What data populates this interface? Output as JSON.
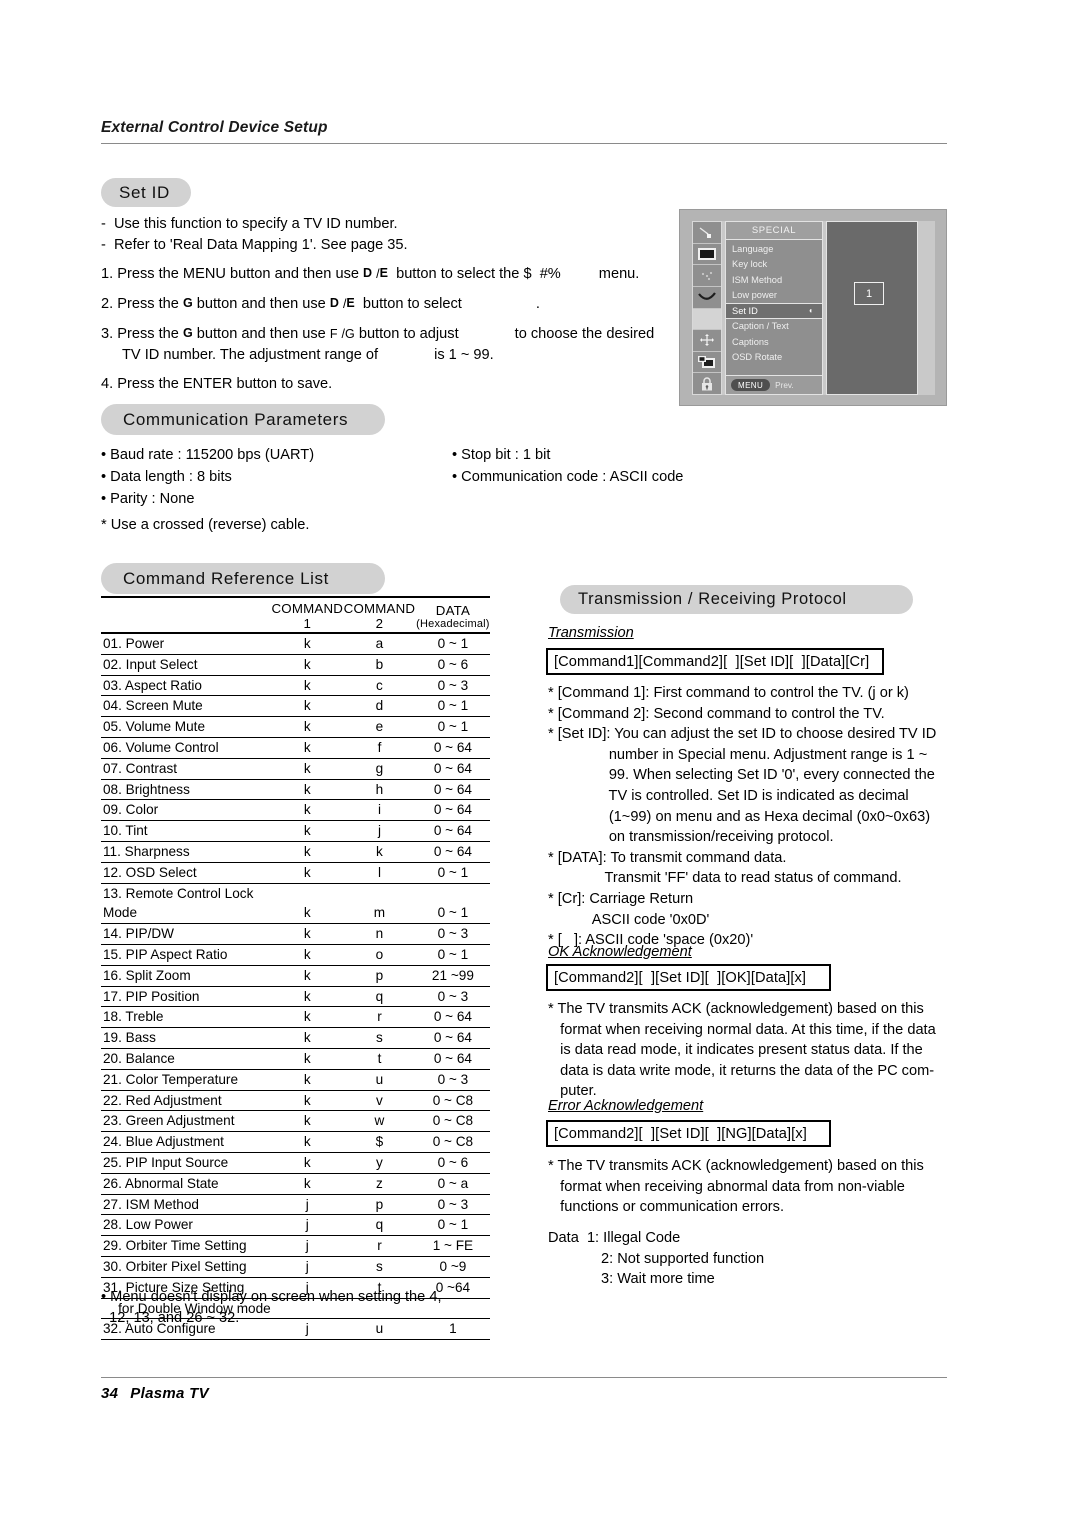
{
  "running_head": "External Control Device Setup",
  "sections": {
    "set_id": {
      "title": "Set ID",
      "dashes": [
        "-  Use this function to specify a TV ID number.",
        "-  Refer to 'Real Data Mapping 1'. See page 35."
      ],
      "steps": [
        {
          "num": "1.",
          "a": "Press the MENU button and then use",
          "sym1": "D",
          "slash": "/",
          "sym2": "E",
          "b": "button to select the",
          "glyph": "$  #%",
          "c": "menu."
        },
        {
          "num": "2.",
          "a": "Press the",
          "sym1": "G",
          "b": "button and then use",
          "sym2": "D",
          "slash": "/",
          "sym3": "E",
          "c": "button to select",
          "d": "."
        },
        {
          "num": "3.",
          "a": "Press the",
          "sym1": "G",
          "b": "button and then use",
          "sym2": "F",
          "slash": "/",
          "sym3": "G",
          "c": "button to adjust",
          "d": "to choose the desired",
          "line2a": "TV ID number. The adjustment range of",
          "line2b": "is 1 ~ 99."
        },
        {
          "num": "4.",
          "a": "Press the ENTER button to save."
        }
      ]
    },
    "osd": {
      "title": "SPECIAL",
      "items": [
        {
          "label": "Language",
          "active": false,
          "arrow": ""
        },
        {
          "label": "Key lock",
          "active": false,
          "arrow": ""
        },
        {
          "label": "ISM Method",
          "active": false,
          "arrow": ""
        },
        {
          "label": "Low power",
          "active": false,
          "arrow": ""
        },
        {
          "label": "Set ID",
          "active": true,
          "arrow": "◖"
        },
        {
          "label": "Caption / Text",
          "active": false,
          "arrow": ""
        },
        {
          "label": "Captions",
          "active": false,
          "arrow": ""
        },
        {
          "label": "OSD Rotate",
          "active": false,
          "arrow": ""
        }
      ],
      "footer_button": "MENU",
      "footer_label": "Prev.",
      "value": "1"
    },
    "communication_parameters": {
      "title": "Communication Parameters",
      "left_bullets": [
        "• Baud rate : 115200 bps (UART)",
        "• Data length : 8 bits",
        "• Parity : None"
      ],
      "right_bullets": [
        "• Stop bit : 1 bit",
        "• Communication code : ASCII code"
      ],
      "note": "* Use a crossed (reverse) cable."
    },
    "command_reference_list": {
      "title": "Command Reference List",
      "columns": [
        "",
        "COMMAND 1",
        "COMMAND 2",
        "DATA"
      ],
      "data_sub_label": "(Hexadecimal)",
      "rows": [
        {
          "name": "01. Power",
          "c1": "k",
          "c2": "a",
          "data": "0 ~ 1"
        },
        {
          "name": "02. Input Select",
          "c1": "k",
          "c2": "b",
          "data": "0 ~ 6"
        },
        {
          "name": "03. Aspect Ratio",
          "c1": "k",
          "c2": "c",
          "data": "0 ~ 3"
        },
        {
          "name": "04. Screen Mute",
          "c1": "k",
          "c2": "d",
          "data": "0 ~ 1"
        },
        {
          "name": "05. Volume Mute",
          "c1": "k",
          "c2": "e",
          "data": "0 ~ 1"
        },
        {
          "name": "06. Volume Control",
          "c1": "k",
          "c2": "f",
          "data": "0 ~ 64"
        },
        {
          "name": "07. Contrast",
          "c1": "k",
          "c2": "g",
          "data": "0 ~ 64"
        },
        {
          "name": "08. Brightness",
          "c1": "k",
          "c2": "h",
          "data": "0 ~ 64"
        },
        {
          "name": "09. Color",
          "c1": "k",
          "c2": "i",
          "data": "0 ~ 64"
        },
        {
          "name": "10. Tint",
          "c1": "k",
          "c2": "j",
          "data": "0 ~ 64"
        },
        {
          "name": "11. Sharpness",
          "c1": "k",
          "c2": "k",
          "data": "0 ~ 64"
        },
        {
          "name": "12. OSD Select",
          "c1": "k",
          "c2": "l",
          "data": "0 ~ 1"
        },
        {
          "name": "13. Remote Control Lock Mode",
          "c1": "k",
          "c2": "m",
          "data": "0 ~ 1"
        },
        {
          "name": "14. PIP/DW",
          "c1": "k",
          "c2": "n",
          "data": "0 ~ 3"
        },
        {
          "name": "15. PIP Aspect Ratio",
          "c1": "k",
          "c2": "o",
          "data": "0 ~ 1"
        },
        {
          "name": "16. Split Zoom",
          "c1": "k",
          "c2": "p",
          "data": "21 ~99"
        },
        {
          "name": "17. PIP Position",
          "c1": "k",
          "c2": "q",
          "data": "0 ~ 3"
        },
        {
          "name": "18. Treble",
          "c1": "k",
          "c2": "r",
          "data": "0 ~ 64"
        },
        {
          "name": "19. Bass",
          "c1": "k",
          "c2": "s",
          "data": "0 ~ 64"
        },
        {
          "name": "20. Balance",
          "c1": "k",
          "c2": "t",
          "data": "0 ~ 64"
        },
        {
          "name": "21. Color Temperature",
          "c1": "k",
          "c2": "u",
          "data": "0 ~ 3"
        },
        {
          "name": "22. Red Adjustment",
          "c1": "k",
          "c2": "v",
          "data": "0 ~ C8"
        },
        {
          "name": "23. Green Adjustment",
          "c1": "k",
          "c2": "w",
          "data": "0 ~ C8"
        },
        {
          "name": "24. Blue Adjustment",
          "c1": "k",
          "c2": "$",
          "data": "0 ~ C8"
        },
        {
          "name": "25. PIP Input Source",
          "c1": "k",
          "c2": "y",
          "data": "0 ~ 6"
        },
        {
          "name": "26. Abnormal State",
          "c1": "k",
          "c2": "z",
          "data": "0 ~ a"
        },
        {
          "name": "27. ISM Method",
          "c1": "j",
          "c2": "p",
          "data": "0 ~ 3"
        },
        {
          "name": "28. Low Power",
          "c1": "j",
          "c2": "q",
          "data": "0 ~ 1"
        },
        {
          "name": "29. Orbiter Time Setting",
          "c1": "j",
          "c2": "r",
          "data": "1 ~ FE"
        },
        {
          "name": "30. Orbiter Pixel Setting",
          "c1": "j",
          "c2": "s",
          "data": "0 ~9"
        },
        {
          "name": "31. Picture Size Setting",
          "c1": "j",
          "c2": "t",
          "data": "0 ~64",
          "continuation": "    for Double Window mode"
        },
        {
          "name": "32. Auto Configure",
          "c1": "j",
          "c2": "u",
          "data": "1"
        }
      ],
      "note": [
        "• Menu doesn't display on screen when setting the 4,",
        "  12, 13, and 26 ~ 32."
      ]
    },
    "protocol": {
      "title": "Transmission / Receiving  Protocol",
      "transmission": {
        "heading": "Transmission",
        "code": "[Command1][Command2][  ][Set ID][  ][Data][Cr]",
        "lines": [
          "* [Command 1]: First command to control the TV. (j or k)",
          "* [Command 2]: Second command to control the TV.",
          "* [Set ID]: You can adjust the set ID to choose desired TV ID",
          "               number in Special menu. Adjustment range is 1 ~",
          "               99. When selecting Set ID '0', every connected the",
          "               TV is controlled. Set ID is indicated as decimal",
          "               (1~99) on menu and as Hexa decimal (0x0~0x63)",
          "               on transmission/receiving protocol.",
          "* [DATA]: To transmit command data.",
          "              Transmit 'FF' data to read status of command.",
          "* [Cr]: Carriage Return",
          "           ASCII code '0x0D'",
          "* [   ]: ASCII code 'space (0x20)'"
        ]
      },
      "ok_ack": {
        "heading": "OK Acknowledgement",
        "code": "[Command2][  ][Set ID][  ][OK][Data][x]",
        "lines": [
          "* The TV transmits ACK (acknowledgement) based on this",
          "   format when receiving normal data. At this time, if the data",
          "   is data read mode, it indicates present status data. If the",
          "   data is data write mode, it returns the data of the PC com-",
          "   puter."
        ]
      },
      "error_ack": {
        "heading": "Error Acknowledgement",
        "code": "[Command2][  ][Set ID][  ][NG][Data][x]",
        "lines": [
          "* The TV transmits ACK (acknowledgement) based on this",
          "   format when receiving abnormal data from non-viable",
          "   functions or communication errors."
        ],
        "data_label": "Data",
        "data_items": [
          "1: Illegal Code",
          "2: Not supported function",
          "3: Wait more time"
        ]
      }
    }
  },
  "footer": {
    "page_number": "34",
    "product": "Plasma TV"
  }
}
